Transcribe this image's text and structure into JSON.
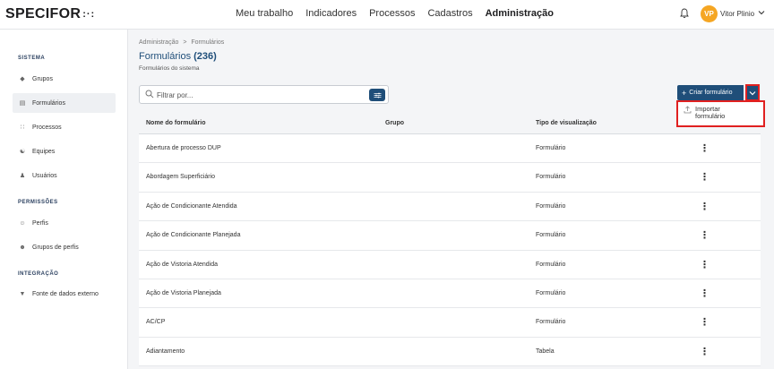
{
  "header": {
    "logo": "SPECIFOR",
    "logo_mark": ":·:",
    "nav": [
      "Meu trabalho",
      "Indicadores",
      "Processos",
      "Cadastros",
      "Administração"
    ],
    "active_nav": "Administração",
    "user_initials": "VP",
    "user_name": "Vitor Plinio",
    "avatar_color": "#f5a623"
  },
  "sidebar": {
    "sections": [
      {
        "title": "SISTEMA",
        "items": [
          {
            "label": "Grupos",
            "icon": "tag-icon"
          },
          {
            "label": "Formulários",
            "icon": "clipboard-icon",
            "active": true
          },
          {
            "label": "Processos",
            "icon": "process-icon"
          },
          {
            "label": "Equipes",
            "icon": "team-icon"
          },
          {
            "label": "Usuários",
            "icon": "user-icon"
          }
        ]
      },
      {
        "title": "PERMISSÕES",
        "items": [
          {
            "label": "Perfis",
            "icon": "profile-icon"
          },
          {
            "label": "Grupos de perfis",
            "icon": "profile-group-icon"
          }
        ]
      },
      {
        "title": "INTEGRAÇÃO",
        "items": [
          {
            "label": "Fonte de dados externo",
            "icon": "plug-icon"
          }
        ]
      }
    ]
  },
  "main": {
    "breadcrumb": [
      "Administração",
      "Formulários"
    ],
    "breadcrumb_separator": ">",
    "title": "Formulários",
    "count": "(236)",
    "subtitle": "Formulários do sistema",
    "search_placeholder": "Filtrar por...",
    "create_button": "Criar formulário",
    "dropdown_item": "Importar formulário",
    "accent": "#1f4e79",
    "highlight": "#e02020"
  },
  "table": {
    "columns": [
      "Nome do formulário",
      "Grupo",
      "Tipo de visualização"
    ],
    "rows": [
      {
        "name": "Abertura de processo DUP",
        "group": "",
        "type": "Formulário"
      },
      {
        "name": "Abordagem Superficiário",
        "group": "",
        "type": "Formulário"
      },
      {
        "name": "Ação de Condicionante Atendida",
        "group": "",
        "type": "Formulário"
      },
      {
        "name": "Ação de Condicionante Planejada",
        "group": "",
        "type": "Formulário"
      },
      {
        "name": "Ação de Vistoria Atendida",
        "group": "",
        "type": "Formulário"
      },
      {
        "name": "Ação de Vistoria Planejada",
        "group": "",
        "type": "Formulário"
      },
      {
        "name": "AC/CP",
        "group": "",
        "type": "Formulário"
      },
      {
        "name": "Adiantamento",
        "group": "",
        "type": "Tabela"
      }
    ]
  }
}
